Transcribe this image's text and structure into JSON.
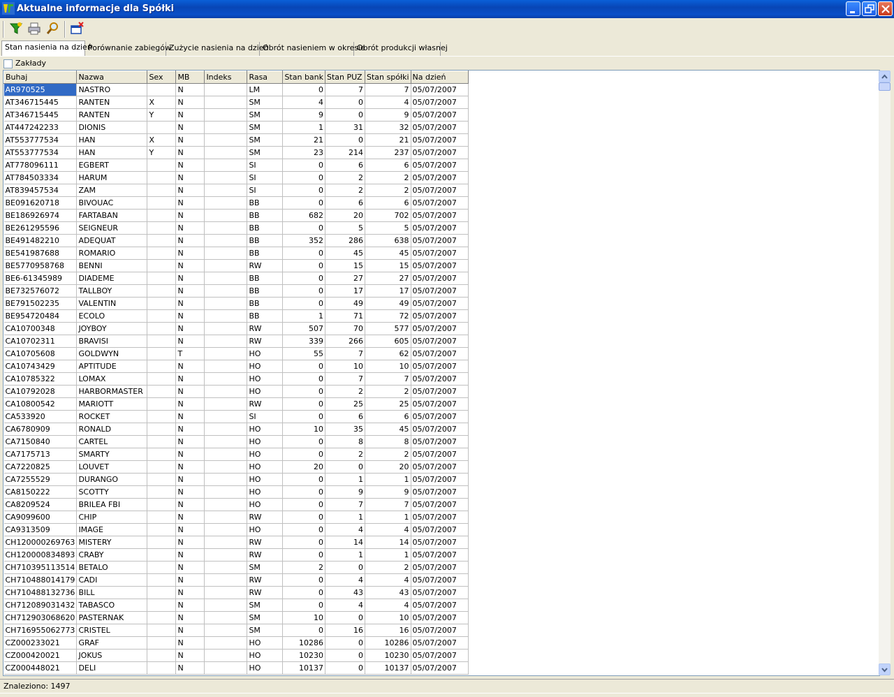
{
  "window": {
    "title": "Aktualne informacje dla Spółki"
  },
  "toolbar": {
    "icons": [
      "filter-icon",
      "print-icon",
      "search-icon",
      "close-window-icon"
    ]
  },
  "tabs": [
    {
      "label": "Stan nasienia na dzień",
      "active": true
    },
    {
      "label": "Porównanie zabiegów"
    },
    {
      "label": "Zużycie nasienia na dzień"
    },
    {
      "label": "Obrót nasieniem w okresie"
    },
    {
      "label": "Obrót produkcji własnej"
    }
  ],
  "filter": {
    "zaklady_label": "Zakłady",
    "zaklady_checked": false
  },
  "table": {
    "columns": [
      "Buhaj",
      "Nazwa",
      "Sex",
      "MB",
      "Indeks",
      "Rasa",
      "Stan bank",
      "Stan PUZ",
      "Stan spółki",
      "Na dzień"
    ],
    "rows": [
      [
        "AR970525",
        "NASTRO",
        "",
        "N",
        "",
        "LM",
        "0",
        "7",
        "7",
        "05/07/2007"
      ],
      [
        "AT346715445",
        "RANTEN",
        "X",
        "N",
        "",
        "SM",
        "4",
        "0",
        "4",
        "05/07/2007"
      ],
      [
        "AT346715445",
        "RANTEN",
        "Y",
        "N",
        "",
        "SM",
        "9",
        "0",
        "9",
        "05/07/2007"
      ],
      [
        "AT447242233",
        "DIONIS",
        "",
        "N",
        "",
        "SM",
        "1",
        "31",
        "32",
        "05/07/2007"
      ],
      [
        "AT553777534",
        "HAN",
        "X",
        "N",
        "",
        "SM",
        "21",
        "0",
        "21",
        "05/07/2007"
      ],
      [
        "AT553777534",
        "HAN",
        "Y",
        "N",
        "",
        "SM",
        "23",
        "214",
        "237",
        "05/07/2007"
      ],
      [
        "AT778096111",
        "EGBERT",
        "",
        "N",
        "",
        "SI",
        "0",
        "6",
        "6",
        "05/07/2007"
      ],
      [
        "AT784503334",
        "HARUM",
        "",
        "N",
        "",
        "SI",
        "0",
        "2",
        "2",
        "05/07/2007"
      ],
      [
        "AT839457534",
        "ZAM",
        "",
        "N",
        "",
        "SI",
        "0",
        "2",
        "2",
        "05/07/2007"
      ],
      [
        "BE091620718",
        "BIVOUAC",
        "",
        "N",
        "",
        "BB",
        "0",
        "6",
        "6",
        "05/07/2007"
      ],
      [
        "BE186926974",
        "FARTABAN",
        "",
        "N",
        "",
        "BB",
        "682",
        "20",
        "702",
        "05/07/2007"
      ],
      [
        "BE261295596",
        "SEIGNEUR",
        "",
        "N",
        "",
        "BB",
        "0",
        "5",
        "5",
        "05/07/2007"
      ],
      [
        "BE491482210",
        "ADEQUAT",
        "",
        "N",
        "",
        "BB",
        "352",
        "286",
        "638",
        "05/07/2007"
      ],
      [
        "BE541987688",
        "ROMARIO",
        "",
        "N",
        "",
        "BB",
        "0",
        "45",
        "45",
        "05/07/2007"
      ],
      [
        "BE5770958768",
        "BENNI",
        "",
        "N",
        "",
        "RW",
        "0",
        "15",
        "15",
        "05/07/2007"
      ],
      [
        "BE6-61345989",
        "DIADEME",
        "",
        "N",
        "",
        "BB",
        "0",
        "27",
        "27",
        "05/07/2007"
      ],
      [
        "BE732576072",
        "TALLBOY",
        "",
        "N",
        "",
        "BB",
        "0",
        "17",
        "17",
        "05/07/2007"
      ],
      [
        "BE791502235",
        "VALENTIN",
        "",
        "N",
        "",
        "BB",
        "0",
        "49",
        "49",
        "05/07/2007"
      ],
      [
        "BE954720484",
        "ECOLO",
        "",
        "N",
        "",
        "BB",
        "1",
        "71",
        "72",
        "05/07/2007"
      ],
      [
        "CA10700348",
        "JOYBOY",
        "",
        "N",
        "",
        "RW",
        "507",
        "70",
        "577",
        "05/07/2007"
      ],
      [
        "CA10702311",
        "BRAVISI",
        "",
        "N",
        "",
        "RW",
        "339",
        "266",
        "605",
        "05/07/2007"
      ],
      [
        "CA10705608",
        "GOLDWYN",
        "",
        "T",
        "",
        "HO",
        "55",
        "7",
        "62",
        "05/07/2007"
      ],
      [
        "CA10743429",
        "APTITUDE",
        "",
        "N",
        "",
        "HO",
        "0",
        "10",
        "10",
        "05/07/2007"
      ],
      [
        "CA10785322",
        "LOMAX",
        "",
        "N",
        "",
        "HO",
        "0",
        "7",
        "7",
        "05/07/2007"
      ],
      [
        "CA10792028",
        "HARBORMASTER",
        "",
        "N",
        "",
        "HO",
        "0",
        "2",
        "2",
        "05/07/2007"
      ],
      [
        "CA10800542",
        "MARIOTT",
        "",
        "N",
        "",
        "RW",
        "0",
        "25",
        "25",
        "05/07/2007"
      ],
      [
        "CA533920",
        "ROCKET",
        "",
        "N",
        "",
        "SI",
        "0",
        "6",
        "6",
        "05/07/2007"
      ],
      [
        "CA6780909",
        "RONALD",
        "",
        "N",
        "",
        "HO",
        "10",
        "35",
        "45",
        "05/07/2007"
      ],
      [
        "CA7150840",
        "CARTEL",
        "",
        "N",
        "",
        "HO",
        "0",
        "8",
        "8",
        "05/07/2007"
      ],
      [
        "CA7175713",
        "SMARTY",
        "",
        "N",
        "",
        "HO",
        "0",
        "2",
        "2",
        "05/07/2007"
      ],
      [
        "CA7220825",
        "LOUVET",
        "",
        "N",
        "",
        "HO",
        "20",
        "0",
        "20",
        "05/07/2007"
      ],
      [
        "CA7255529",
        "DURANGO",
        "",
        "N",
        "",
        "HO",
        "0",
        "1",
        "1",
        "05/07/2007"
      ],
      [
        "CA8150222",
        "SCOTTY",
        "",
        "N",
        "",
        "HO",
        "0",
        "9",
        "9",
        "05/07/2007"
      ],
      [
        "CA8209524",
        "BRILEA FBI",
        "",
        "N",
        "",
        "HO",
        "0",
        "7",
        "7",
        "05/07/2007"
      ],
      [
        "CA9099600",
        "CHIP",
        "",
        "N",
        "",
        "RW",
        "0",
        "1",
        "1",
        "05/07/2007"
      ],
      [
        "CA9313509",
        "IMAGE",
        "",
        "N",
        "",
        "HO",
        "0",
        "4",
        "4",
        "05/07/2007"
      ],
      [
        "CH120000269763",
        "MISTERY",
        "",
        "N",
        "",
        "RW",
        "0",
        "14",
        "14",
        "05/07/2007"
      ],
      [
        "CH120000834893",
        "CRABY",
        "",
        "N",
        "",
        "RW",
        "0",
        "1",
        "1",
        "05/07/2007"
      ],
      [
        "CH710395113514",
        "BETALO",
        "",
        "N",
        "",
        "SM",
        "2",
        "0",
        "2",
        "05/07/2007"
      ],
      [
        "CH710488014179",
        "CADI",
        "",
        "N",
        "",
        "RW",
        "0",
        "4",
        "4",
        "05/07/2007"
      ],
      [
        "CH710488132736",
        "BILL",
        "",
        "N",
        "",
        "RW",
        "0",
        "43",
        "43",
        "05/07/2007"
      ],
      [
        "CH712089031432",
        "TABASCO",
        "",
        "N",
        "",
        "SM",
        "0",
        "4",
        "4",
        "05/07/2007"
      ],
      [
        "CH712903068620",
        "PASTERNAK",
        "",
        "N",
        "",
        "SM",
        "10",
        "0",
        "10",
        "05/07/2007"
      ],
      [
        "CH716955062773",
        "CRISTEL",
        "",
        "N",
        "",
        "SM",
        "0",
        "16",
        "16",
        "05/07/2007"
      ],
      [
        "CZ000233021",
        "GRAF",
        "",
        "N",
        "",
        "HO",
        "10286",
        "0",
        "10286",
        "05/07/2007"
      ],
      [
        "CZ000420021",
        "JOKUS",
        "",
        "N",
        "",
        "HO",
        "10230",
        "0",
        "10230",
        "05/07/2007"
      ],
      [
        "CZ000448021",
        "DELI",
        "",
        "N",
        "",
        "HO",
        "10137",
        "0",
        "10137",
        "05/07/2007"
      ]
    ]
  },
  "status": {
    "text": "Znaleziono: 1497"
  }
}
